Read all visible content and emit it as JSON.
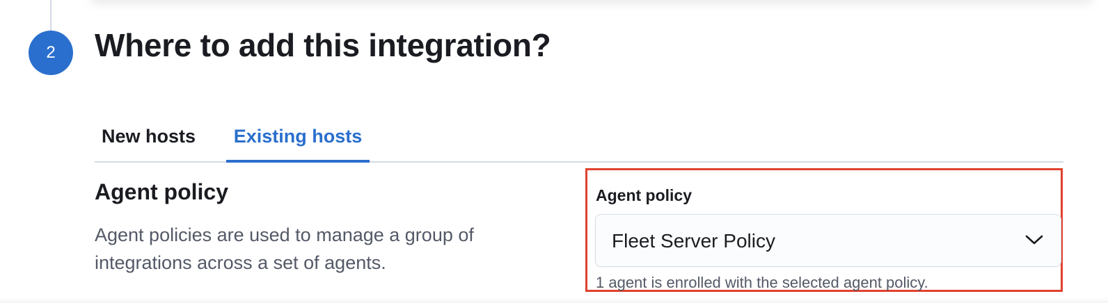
{
  "step": {
    "number": "2",
    "title": "Where to add this integration?"
  },
  "tabs": [
    {
      "label": "New hosts",
      "selected": false
    },
    {
      "label": "Existing hosts",
      "selected": true
    }
  ],
  "section": {
    "title": "Agent policy",
    "description": "Agent policies are used to manage a group of integrations across a set of agents."
  },
  "agent_policy_field": {
    "label": "Agent policy",
    "selected_value": "Fleet Server Policy",
    "help_text": "1 agent is enrolled with the selected agent policy.",
    "icon": "chevron-down-icon"
  },
  "colors": {
    "accent": "#2a6fcd",
    "highlight_border": "#e0412d",
    "text_primary": "#1a1c21",
    "text_secondary": "#535966"
  }
}
